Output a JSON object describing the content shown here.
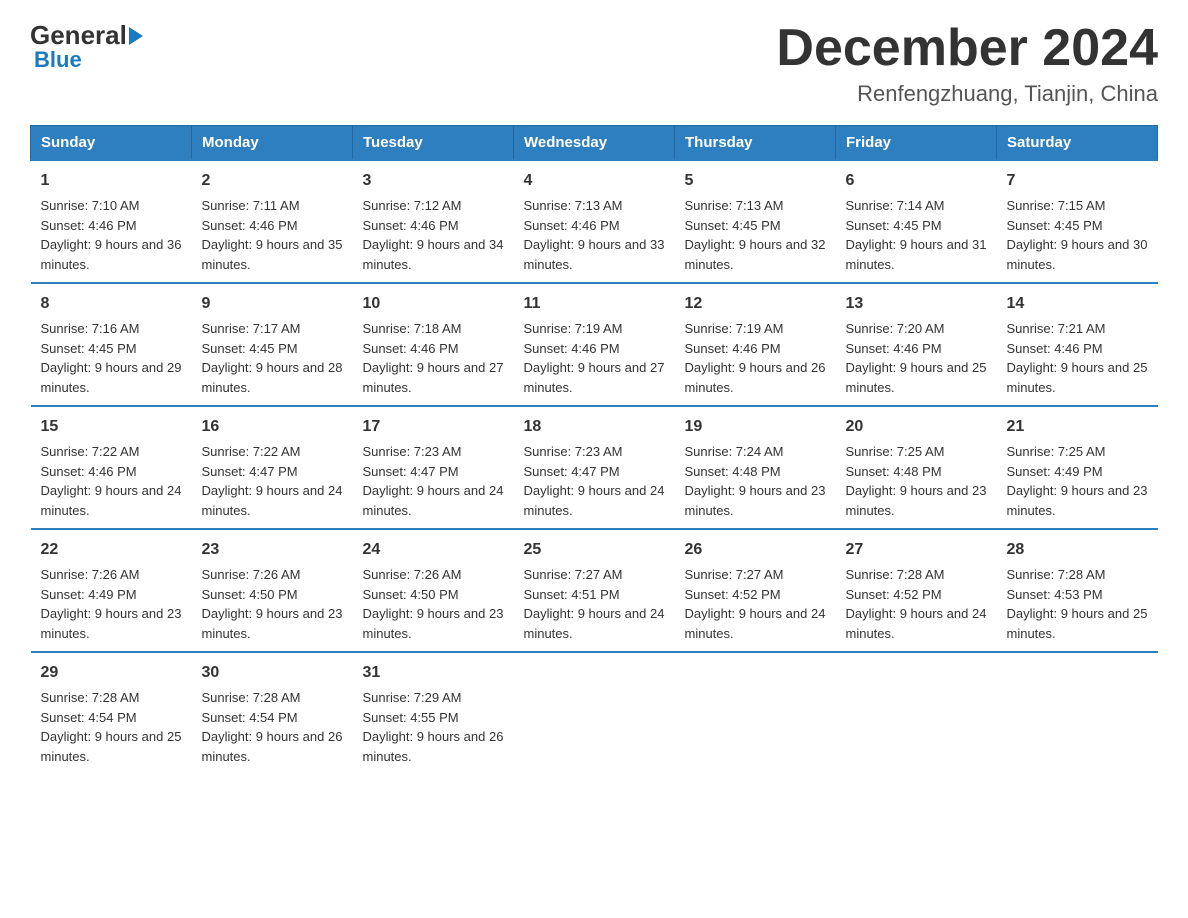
{
  "logo": {
    "general": "General",
    "blue": "Blue"
  },
  "header": {
    "title": "December 2024",
    "subtitle": "Renfengzhuang, Tianjin, China"
  },
  "weekdays": [
    "Sunday",
    "Monday",
    "Tuesday",
    "Wednesday",
    "Thursday",
    "Friday",
    "Saturday"
  ],
  "weeks": [
    [
      {
        "day": "1",
        "sunrise": "7:10 AM",
        "sunset": "4:46 PM",
        "daylight": "9 hours and 36 minutes."
      },
      {
        "day": "2",
        "sunrise": "7:11 AM",
        "sunset": "4:46 PM",
        "daylight": "9 hours and 35 minutes."
      },
      {
        "day": "3",
        "sunrise": "7:12 AM",
        "sunset": "4:46 PM",
        "daylight": "9 hours and 34 minutes."
      },
      {
        "day": "4",
        "sunrise": "7:13 AM",
        "sunset": "4:46 PM",
        "daylight": "9 hours and 33 minutes."
      },
      {
        "day": "5",
        "sunrise": "7:13 AM",
        "sunset": "4:45 PM",
        "daylight": "9 hours and 32 minutes."
      },
      {
        "day": "6",
        "sunrise": "7:14 AM",
        "sunset": "4:45 PM",
        "daylight": "9 hours and 31 minutes."
      },
      {
        "day": "7",
        "sunrise": "7:15 AM",
        "sunset": "4:45 PM",
        "daylight": "9 hours and 30 minutes."
      }
    ],
    [
      {
        "day": "8",
        "sunrise": "7:16 AM",
        "sunset": "4:45 PM",
        "daylight": "9 hours and 29 minutes."
      },
      {
        "day": "9",
        "sunrise": "7:17 AM",
        "sunset": "4:45 PM",
        "daylight": "9 hours and 28 minutes."
      },
      {
        "day": "10",
        "sunrise": "7:18 AM",
        "sunset": "4:46 PM",
        "daylight": "9 hours and 27 minutes."
      },
      {
        "day": "11",
        "sunrise": "7:19 AM",
        "sunset": "4:46 PM",
        "daylight": "9 hours and 27 minutes."
      },
      {
        "day": "12",
        "sunrise": "7:19 AM",
        "sunset": "4:46 PM",
        "daylight": "9 hours and 26 minutes."
      },
      {
        "day": "13",
        "sunrise": "7:20 AM",
        "sunset": "4:46 PM",
        "daylight": "9 hours and 25 minutes."
      },
      {
        "day": "14",
        "sunrise": "7:21 AM",
        "sunset": "4:46 PM",
        "daylight": "9 hours and 25 minutes."
      }
    ],
    [
      {
        "day": "15",
        "sunrise": "7:22 AM",
        "sunset": "4:46 PM",
        "daylight": "9 hours and 24 minutes."
      },
      {
        "day": "16",
        "sunrise": "7:22 AM",
        "sunset": "4:47 PM",
        "daylight": "9 hours and 24 minutes."
      },
      {
        "day": "17",
        "sunrise": "7:23 AM",
        "sunset": "4:47 PM",
        "daylight": "9 hours and 24 minutes."
      },
      {
        "day": "18",
        "sunrise": "7:23 AM",
        "sunset": "4:47 PM",
        "daylight": "9 hours and 24 minutes."
      },
      {
        "day": "19",
        "sunrise": "7:24 AM",
        "sunset": "4:48 PM",
        "daylight": "9 hours and 23 minutes."
      },
      {
        "day": "20",
        "sunrise": "7:25 AM",
        "sunset": "4:48 PM",
        "daylight": "9 hours and 23 minutes."
      },
      {
        "day": "21",
        "sunrise": "7:25 AM",
        "sunset": "4:49 PM",
        "daylight": "9 hours and 23 minutes."
      }
    ],
    [
      {
        "day": "22",
        "sunrise": "7:26 AM",
        "sunset": "4:49 PM",
        "daylight": "9 hours and 23 minutes."
      },
      {
        "day": "23",
        "sunrise": "7:26 AM",
        "sunset": "4:50 PM",
        "daylight": "9 hours and 23 minutes."
      },
      {
        "day": "24",
        "sunrise": "7:26 AM",
        "sunset": "4:50 PM",
        "daylight": "9 hours and 23 minutes."
      },
      {
        "day": "25",
        "sunrise": "7:27 AM",
        "sunset": "4:51 PM",
        "daylight": "9 hours and 24 minutes."
      },
      {
        "day": "26",
        "sunrise": "7:27 AM",
        "sunset": "4:52 PM",
        "daylight": "9 hours and 24 minutes."
      },
      {
        "day": "27",
        "sunrise": "7:28 AM",
        "sunset": "4:52 PM",
        "daylight": "9 hours and 24 minutes."
      },
      {
        "day": "28",
        "sunrise": "7:28 AM",
        "sunset": "4:53 PM",
        "daylight": "9 hours and 25 minutes."
      }
    ],
    [
      {
        "day": "29",
        "sunrise": "7:28 AM",
        "sunset": "4:54 PM",
        "daylight": "9 hours and 25 minutes."
      },
      {
        "day": "30",
        "sunrise": "7:28 AM",
        "sunset": "4:54 PM",
        "daylight": "9 hours and 26 minutes."
      },
      {
        "day": "31",
        "sunrise": "7:29 AM",
        "sunset": "4:55 PM",
        "daylight": "9 hours and 26 minutes."
      },
      null,
      null,
      null,
      null
    ]
  ]
}
